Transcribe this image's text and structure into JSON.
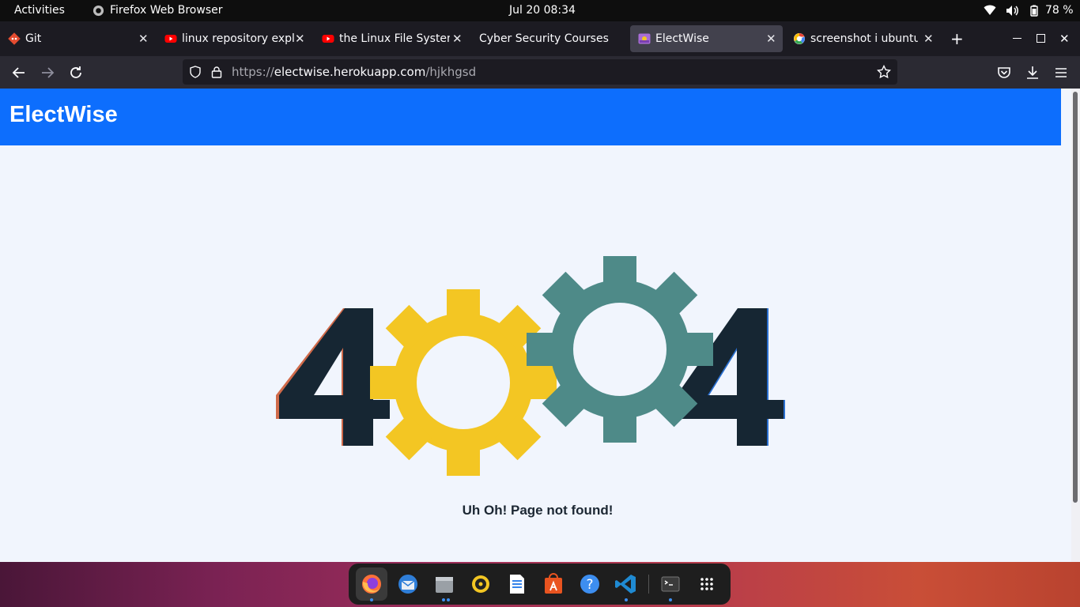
{
  "topbar": {
    "activities": "Activities",
    "app_name": "Firefox Web Browser",
    "clock": "Jul 20  08:34",
    "battery": "78 %"
  },
  "tabs": [
    {
      "label": "Git",
      "icon": "git-icon",
      "active": false
    },
    {
      "label": "linux repository expla",
      "icon": "youtube-icon",
      "active": false
    },
    {
      "label": "the Linux File System",
      "icon": "youtube-icon",
      "active": false
    },
    {
      "label": "Cyber Security Courses :",
      "icon": "",
      "active": false
    },
    {
      "label": "ElectWise",
      "icon": "site-icon",
      "active": true
    },
    {
      "label": "screenshot i ubuntu -",
      "icon": "google-icon",
      "active": false
    }
  ],
  "urlbar": {
    "scheme": "https://",
    "host": "electwise.herokuapp.com",
    "path": "/hjkhgsd"
  },
  "page": {
    "brand": "ElectWise",
    "error_code": "404",
    "message": "Uh Oh! Page not found!"
  },
  "colors": {
    "header_blue": "#0d6efd",
    "gear_yellow": "#f3c623",
    "gear_teal": "#4e8a88",
    "digit_dark": "#162633"
  },
  "dock": [
    "firefox-icon",
    "thunderbird-icon",
    "files-icon",
    "rhythmbox-icon",
    "writer-icon",
    "software-icon",
    "help-icon",
    "vscode-icon",
    "terminal-icon",
    "app-grid-icon"
  ]
}
